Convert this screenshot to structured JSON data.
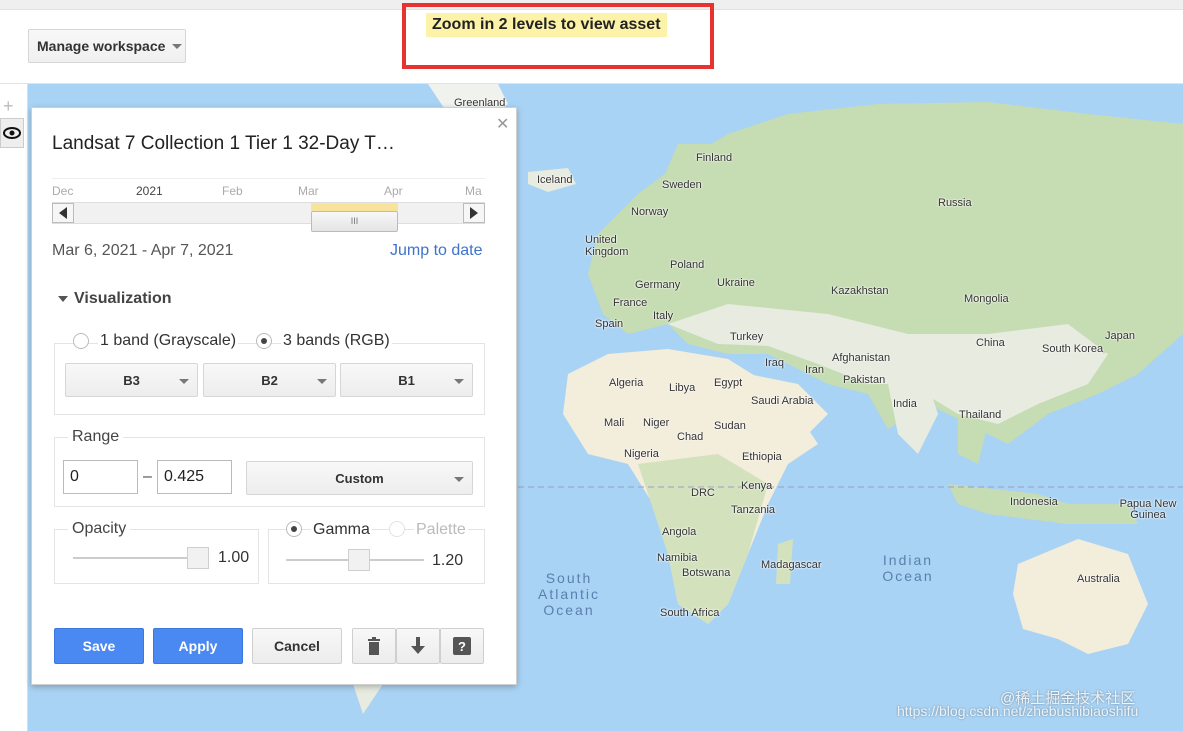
{
  "toolbar": {
    "manage_label": "Manage workspace"
  },
  "banner": {
    "zoom_message": "Zoom in 2 levels to view asset"
  },
  "layer": {
    "title": "Landsat 7 Collection 1 Tier 1 32-Day T…",
    "timeline_months": [
      "Dec",
      "2021",
      "Feb",
      "Mar",
      "Apr",
      "Ma"
    ],
    "handle_grip": "III",
    "date_range": "Mar 6, 2021 - Apr 7, 2021",
    "jump_label": "Jump to date"
  },
  "visualization": {
    "heading": "Visualization",
    "band_modes": [
      "1 band (Grayscale)",
      "3 bands (RGB)"
    ],
    "selected_mode": "3 bands (RGB)",
    "bands": [
      "B3",
      "B2",
      "B1"
    ],
    "range": {
      "label": "Range",
      "min": "0",
      "separator": "–",
      "max": "0.425",
      "preset": "Custom"
    },
    "opacity": {
      "label": "Opacity",
      "value": "1.00"
    },
    "gamma": {
      "label": "Gamma",
      "value": "1.20",
      "selected": true
    },
    "palette": {
      "label": "Palette"
    }
  },
  "actions": {
    "save": "Save",
    "apply": "Apply",
    "cancel": "Cancel",
    "icons": [
      "trash-icon",
      "download-arrow-icon",
      "help-icon"
    ]
  },
  "map": {
    "labels": [
      "Greenland",
      "Iceland",
      "Finland",
      "Sweden",
      "Norway",
      "Russia",
      "United Kingdom",
      "Poland",
      "Germany",
      "Ukraine",
      "Kazakhstan",
      "Mongolia",
      "France",
      "Spain",
      "Italy",
      "Turkey",
      "China",
      "Japan",
      "South Korea",
      "Afghanistan",
      "Iraq",
      "Iran",
      "Pakistan",
      "India",
      "Thailand",
      "Algeria",
      "Libya",
      "Egypt",
      "Saudi Arabia",
      "Mali",
      "Niger",
      "Chad",
      "Sudan",
      "Nigeria",
      "Ethiopia",
      "DRC",
      "Kenya",
      "Tanzania",
      "Indonesia",
      "Papua New Guinea",
      "Angola",
      "Namibia",
      "Botswana",
      "Madagascar",
      "South Africa",
      "Australia"
    ],
    "oceans": [
      "South Atlantic Ocean",
      "Indian Ocean"
    ],
    "colors": {
      "water": "#a9d3f4",
      "land": "#e8ebe0",
      "forest": "#c6dcb2",
      "desert": "#f3eddc"
    }
  },
  "watermark": {
    "line1": "@稀土掘金技术社区",
    "line2": "https://blog.csdn.net/zhebushibiaoshifu"
  }
}
